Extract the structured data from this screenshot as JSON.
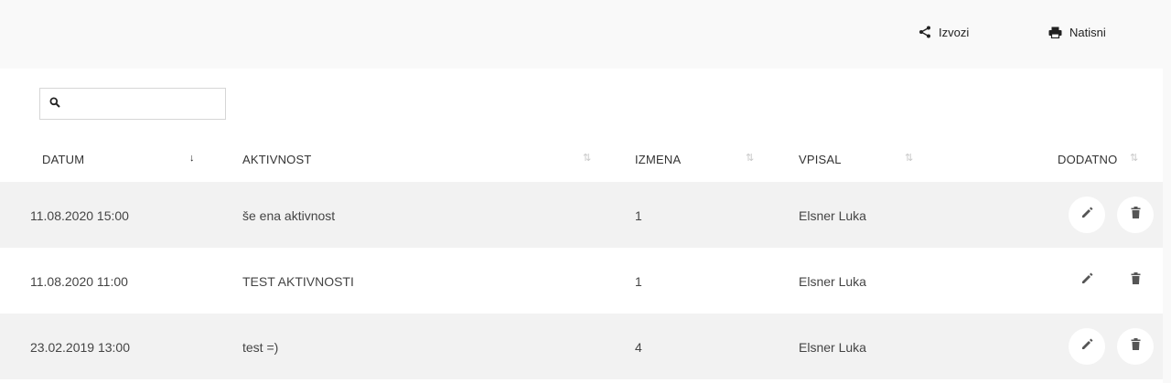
{
  "toolbar": {
    "export_label": "Izvozi",
    "print_label": "Natisni"
  },
  "search": {
    "value": "",
    "placeholder": ""
  },
  "table": {
    "columns": [
      {
        "label": "DATUM",
        "sort": "descending"
      },
      {
        "label": "AKTIVNOST",
        "sort": "none"
      },
      {
        "label": "IZMENA",
        "sort": "none"
      },
      {
        "label": "VPISAL",
        "sort": "none"
      },
      {
        "label": "DODATNO",
        "sort": "none"
      }
    ],
    "rows": [
      {
        "datum": "11.08.2020 15:00",
        "aktivnost": "še ena aktivnost",
        "izmena": "1",
        "vpisal": "Elsner Luka"
      },
      {
        "datum": "11.08.2020 11:00",
        "aktivnost": "TEST AKTIVNOSTI",
        "izmena": "1",
        "vpisal": "Elsner Luka"
      },
      {
        "datum": "23.02.2019 13:00",
        "aktivnost": "test =)",
        "izmena": "4",
        "vpisal": "Elsner Luka"
      }
    ]
  },
  "icons": {
    "export": "share-icon",
    "print": "printer-icon",
    "search": "search-icon",
    "edit": "pencil-icon",
    "delete": "trash-icon"
  },
  "colors": {
    "row_alt": "#f2f2f2",
    "background": "#f9f9f9"
  }
}
